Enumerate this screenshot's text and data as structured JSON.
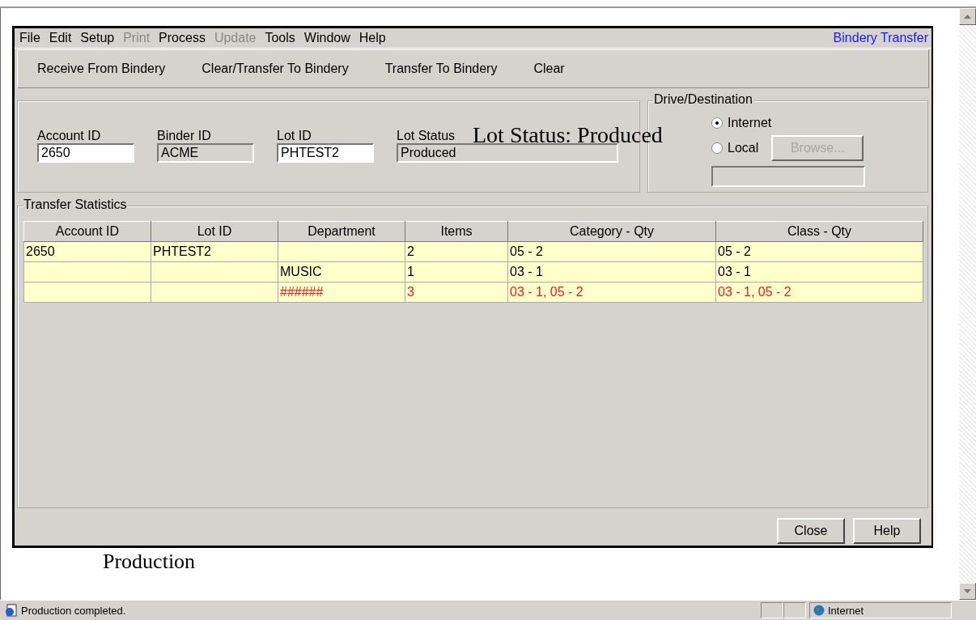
{
  "menu": [
    {
      "label": "File",
      "disabled": false
    },
    {
      "label": "Edit",
      "disabled": false
    },
    {
      "label": "Setup",
      "disabled": false
    },
    {
      "label": "Print",
      "disabled": true
    },
    {
      "label": "Process",
      "disabled": false
    },
    {
      "label": "Update",
      "disabled": true
    },
    {
      "label": "Tools",
      "disabled": false
    },
    {
      "label": "Window",
      "disabled": false
    },
    {
      "label": "Help",
      "disabled": false
    }
  ],
  "form_title": "Bindery Transfer",
  "toolbar": [
    "Receive From Bindery",
    "Clear/Transfer To Bindery",
    "Transfer To Bindery",
    "Clear"
  ],
  "fields": [
    {
      "label": "Account ID",
      "value": "2650",
      "disabled": false
    },
    {
      "label": "Binder ID",
      "value": "ACME",
      "disabled": true
    },
    {
      "label": "Lot ID",
      "value": "PHTEST2",
      "disabled": false
    },
    {
      "label": "Lot Status",
      "value": "Produced",
      "disabled": true
    }
  ],
  "annotation": "Lot Status: Produced",
  "destination": {
    "title": "Drive/Destination",
    "options": [
      {
        "label": "Internet",
        "selected": true
      },
      {
        "label": "Local",
        "selected": false
      }
    ],
    "browse": {
      "label": "Browse...",
      "disabled": true
    }
  },
  "statistics": {
    "title": "Transfer Statistics",
    "columns": [
      "Account ID",
      "Lot ID",
      "Department",
      "Items",
      "Category - Qty",
      "Class - Qty"
    ],
    "rows": [
      {
        "cells": [
          "2650",
          "PHTEST2",
          "",
          "2",
          "05 - 2",
          "05 - 2"
        ],
        "flagged": false
      },
      {
        "cells": [
          "",
          "",
          "MUSIC",
          "1",
          "03 - 1",
          "03 - 1"
        ],
        "flagged": false
      },
      {
        "cells": [
          "",
          "",
          "######",
          "3",
          "03 - 1, 05 - 2",
          "03 - 1, 05 - 2"
        ],
        "flagged": true
      }
    ]
  },
  "buttons": [
    "Close",
    "Help"
  ],
  "caption": "Production",
  "status_bar": {
    "message": "Production completed.",
    "zone": "Internet"
  }
}
